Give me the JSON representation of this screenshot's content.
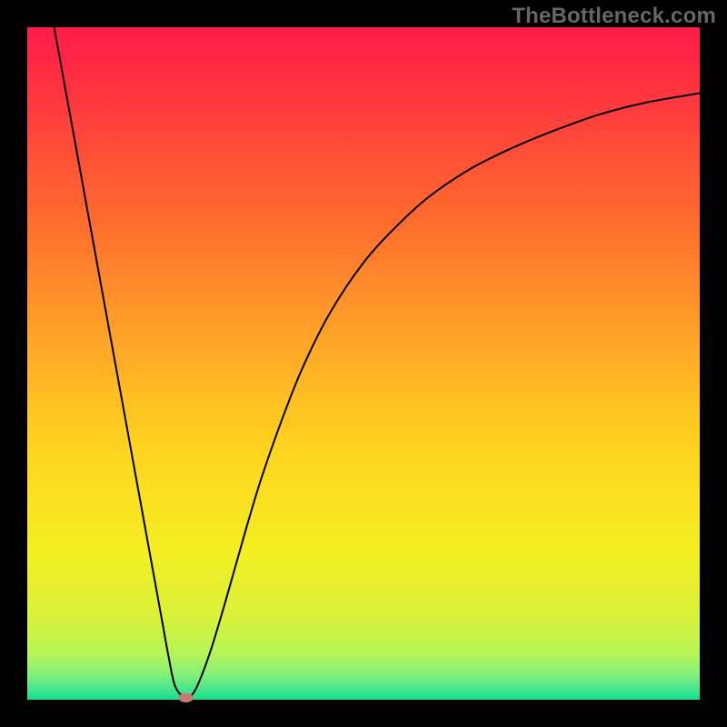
{
  "watermark": "TheBottleneck.com",
  "chart_data": {
    "type": "line",
    "title": "",
    "xlabel": "",
    "ylabel": "",
    "xlim": [
      0,
      100
    ],
    "ylim": [
      0,
      100
    ],
    "axes_visible": false,
    "grid": false,
    "background": {
      "description": "vertical rainbow gradient from red (top) to green (bottom)",
      "stops": [
        {
          "offset": 0.0,
          "color": "#ff1b49"
        },
        {
          "offset": 0.12,
          "color": "#ff3b3d"
        },
        {
          "offset": 0.28,
          "color": "#ff6a2e"
        },
        {
          "offset": 0.45,
          "color": "#ffa028"
        },
        {
          "offset": 0.62,
          "color": "#ffd21f"
        },
        {
          "offset": 0.78,
          "color": "#f4ef22"
        },
        {
          "offset": 0.88,
          "color": "#d8f23b"
        },
        {
          "offset": 0.935,
          "color": "#b2f45a"
        },
        {
          "offset": 0.965,
          "color": "#7ef07a"
        },
        {
          "offset": 0.985,
          "color": "#44e58e"
        },
        {
          "offset": 1.0,
          "color": "#16dc8b"
        }
      ]
    },
    "series": [
      {
        "name": "bottleneck-curve",
        "color": "#000000",
        "stroke_width": 2,
        "x": [
          4.0,
          6.0,
          8.0,
          10.0,
          12.0,
          14.0,
          16.0,
          18.0,
          20.0,
          21.0,
          22.0,
          23.6,
          25.0,
          27.0,
          29.0,
          31.0,
          33.0,
          35.0,
          38.0,
          41.0,
          45.0,
          50.0,
          55.0,
          60.0,
          66.0,
          72.0,
          78.0,
          85.0,
          92.0,
          100.0
        ],
        "y": [
          100.0,
          89.0,
          78.0,
          67.0,
          56.0,
          45.0,
          34.0,
          23.0,
          12.0,
          6.5,
          2.0,
          0.3,
          1.5,
          6.5,
          13.0,
          20.0,
          27.0,
          33.5,
          42.0,
          49.5,
          57.5,
          65.0,
          70.5,
          75.0,
          79.0,
          82.0,
          84.5,
          87.0,
          88.8,
          90.2
        ]
      }
    ],
    "minimum_marker": {
      "x": 23.6,
      "y": 0.3,
      "rx": 1.1,
      "ry": 0.7,
      "color": "#c97a6a"
    },
    "border": {
      "color": "#000000",
      "width": 30
    }
  }
}
